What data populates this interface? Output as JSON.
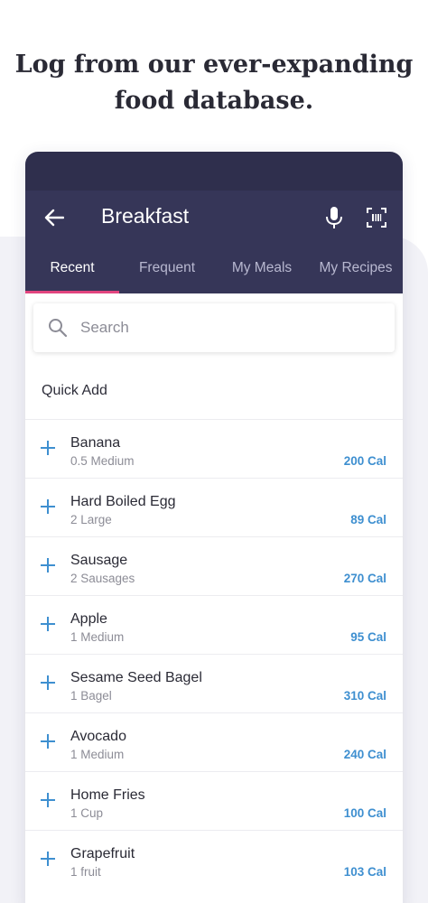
{
  "headline": {
    "line1": "Log from our ever-expanding",
    "line2": "food database."
  },
  "appbar": {
    "title": "Breakfast"
  },
  "tabs": [
    {
      "label": "Recent",
      "active": true
    },
    {
      "label": "Frequent",
      "active": false
    },
    {
      "label": "My Meals",
      "active": false
    },
    {
      "label": "My Recipes",
      "active": false
    }
  ],
  "search": {
    "placeholder": "Search"
  },
  "section": {
    "title": "Quick Add"
  },
  "foods": [
    {
      "name": "Banana",
      "serving": "0.5 Medium",
      "calories": "200 Cal"
    },
    {
      "name": "Hard Boiled Egg",
      "serving": "2 Large",
      "calories": "89 Cal"
    },
    {
      "name": "Sausage",
      "serving": "2 Sausages",
      "calories": "270 Cal"
    },
    {
      "name": "Apple",
      "serving": "1 Medium",
      "calories": "95 Cal"
    },
    {
      "name": "Sesame Seed Bagel",
      "serving": "1 Bagel",
      "calories": "310 Cal"
    },
    {
      "name": "Avocado",
      "serving": "1 Medium",
      "calories": "240 Cal"
    },
    {
      "name": "Home Fries",
      "serving": "1 Cup",
      "calories": "100 Cal"
    },
    {
      "name": "Grapefruit",
      "serving": "1 fruit",
      "calories": "103 Cal"
    }
  ],
  "colors": {
    "appbar": "#363658",
    "statusbar": "#2f2f4d",
    "tab_indicator": "#e2457f",
    "calorie_text": "#3e8fd0",
    "plus_icon": "#3e8fd0"
  },
  "icons": [
    "back-arrow-icon",
    "microphone-icon",
    "barcode-scan-icon",
    "search-icon",
    "plus-icon"
  ]
}
